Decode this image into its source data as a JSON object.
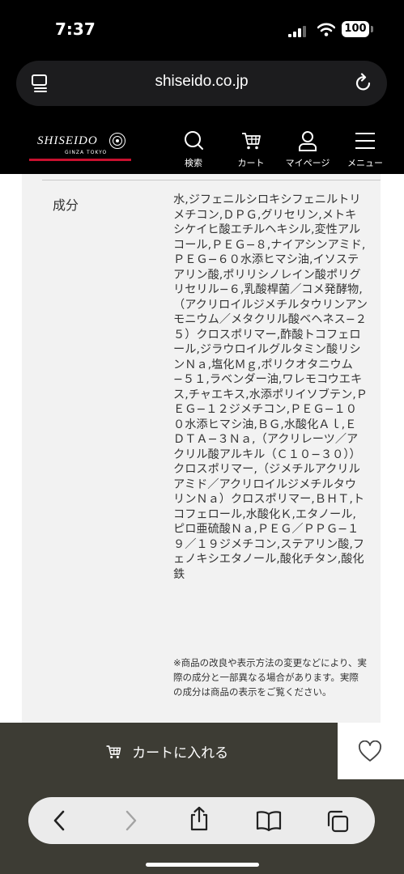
{
  "status": {
    "time": "7:37",
    "battery": "100"
  },
  "urlbar": {
    "domain": "shiseido.co.jp"
  },
  "header": {
    "logo_text": "SHISEIDO",
    "logo_sub": "GINZA TOKYO",
    "nav": {
      "search": "検索",
      "cart": "カート",
      "mypage": "マイページ",
      "menu": "メニュー"
    }
  },
  "product": {
    "ingredients_label": "成分",
    "ingredients": "水,ジフェニルシロキシフェニルトリメチコン,ＤＰＧ,グリセリン,メトキシケイヒ酸エチルヘキシル,変性アルコール,ＰＥＧ−８,ナイアシンアミド,ＰＥＧ−６０水添ヒマシ油,イソステアリン酸,ポリリシノレイン酸ポリグリセリル−６,乳酸桿菌／コメ発酵物,（アクリロイルジメチルタウリンアンモニウム／メタクリル酸ベヘネス−２５）クロスポリマー,酢酸トコフェロール,ジラウロイルグルタミン酸リシンＮａ,塩化Ｍｇ,ポリクオタニウム−５１,ラベンダー油,ワレモコウエキス,チャエキス,水添ポリイソブテン,ＰＥＧ−１２ジメチコン,ＰＥＧ−１００水添ヒマシ油,ＢＧ,水酸化Ａｌ,ＥＤＴＡ−３Ｎａ,（アクリレーツ／アクリル酸アルキル（Ｃ１０−３０））クロスポリマー,（ジメチルアクリルアミド／アクリロイルジメチルタウリンＮａ）クロスポリマー,ＢＨＴ,トコフェロール,水酸化Ｋ,エタノール,ピロ亜硫酸Ｎａ,ＰＥＧ／ＰＰＧ−１９／１９ジメチコン,ステアリン酸,フェノキシエタノール,酸化チタン,酸化鉄",
    "note": "※商品の改良や表示方法の変更などにより、実際の成分と一部異なる場合があります。実際の成分は商品の表示をご覧ください。"
  },
  "actions": {
    "add_to_cart": "カートに入れる"
  },
  "colors": {
    "accent_red": "#c8102e",
    "cartbar_bg": "#3d3c34"
  }
}
